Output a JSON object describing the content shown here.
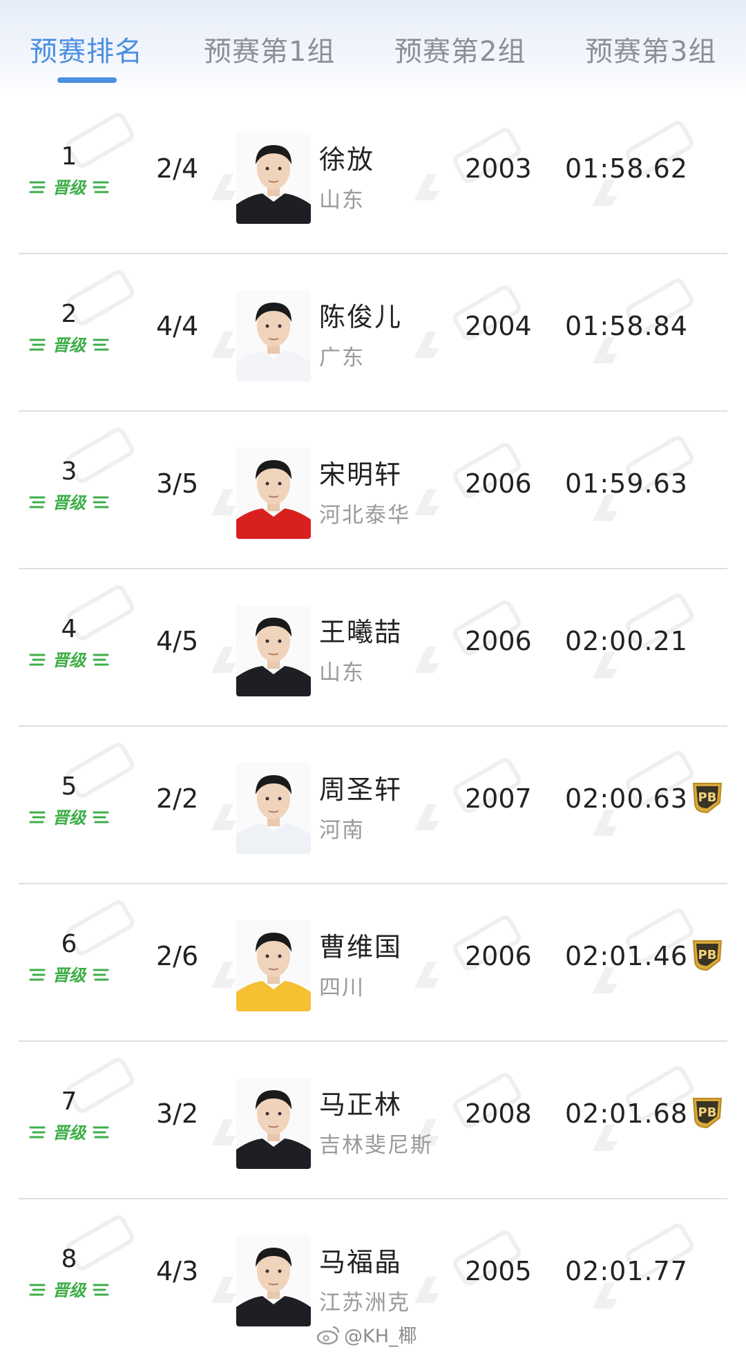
{
  "tabs": [
    {
      "label": "预赛排名",
      "active": true
    },
    {
      "label": "预赛第1组",
      "active": false
    },
    {
      "label": "预赛第2组",
      "active": false
    },
    {
      "label": "预赛第3组",
      "active": false
    }
  ],
  "badge_label": "晋级",
  "pb_label": "PB",
  "rows": [
    {
      "rank": "1",
      "lane": "2/4",
      "name": "徐放",
      "team": "山东",
      "year": "2003",
      "time": "01:58.62",
      "pb": false,
      "shirt": "#1d1f24"
    },
    {
      "rank": "2",
      "lane": "4/4",
      "name": "陈俊儿",
      "team": "广东",
      "year": "2004",
      "time": "01:58.84",
      "pb": false,
      "shirt": "#f2f4f8"
    },
    {
      "rank": "3",
      "lane": "3/5",
      "name": "宋明轩",
      "team": "河北泰华",
      "year": "2006",
      "time": "01:59.63",
      "pb": false,
      "shirt": "#d8211f"
    },
    {
      "rank": "4",
      "lane": "4/5",
      "name": "王曦喆",
      "team": "山东",
      "year": "2006",
      "time": "02:00.21",
      "pb": false,
      "shirt": "#1d1f24"
    },
    {
      "rank": "5",
      "lane": "2/2",
      "name": "周圣轩",
      "team": "河南",
      "year": "2007",
      "time": "02:00.63",
      "pb": true,
      "shirt": "#eef1f6"
    },
    {
      "rank": "6",
      "lane": "2/6",
      "name": "曹维国",
      "team": "四川",
      "year": "2006",
      "time": "02:01.46",
      "pb": true,
      "shirt": "#f5c132"
    },
    {
      "rank": "7",
      "lane": "3/2",
      "name": "马正林",
      "team": "吉林斐尼斯",
      "year": "2008",
      "time": "02:01.68",
      "pb": true,
      "shirt": "#1d1f24"
    },
    {
      "rank": "8",
      "lane": "4/3",
      "name": "马福晶",
      "team": "江苏洲克",
      "year": "2005",
      "time": "02:01.77",
      "pb": false,
      "shirt": "#1d1f24"
    }
  ],
  "credit": "@KH_椰",
  "colors": {
    "accent": "#4a8fe0",
    "badge": "#3dae48",
    "pb_gold": "#d9a93a"
  },
  "icons": {
    "badge": "qualified-badge-icon",
    "pb": "personal-best-icon",
    "credit": "weibo-icon"
  }
}
